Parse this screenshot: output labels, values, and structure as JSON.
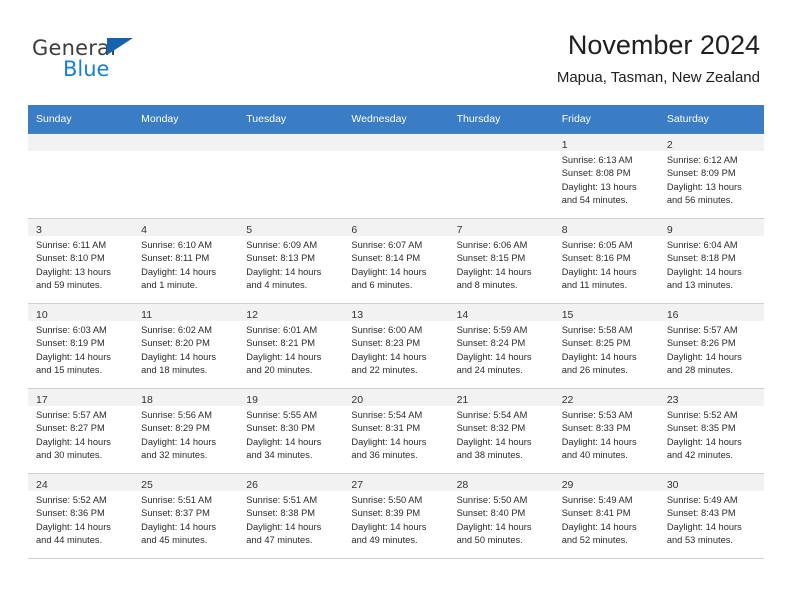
{
  "brand": {
    "name_top": "General",
    "name_bottom": "Blue",
    "triangle_color": "#1464ad",
    "blue_color": "#1a7fd4"
  },
  "header": {
    "title": "November 2024",
    "subtitle": "Mapua, Tasman, New Zealand"
  },
  "theme": {
    "header_row_bg": "#3b7dc4",
    "day_band_bg": "#f2f2f2",
    "cell_border": "#4c84c0"
  },
  "weekdays": [
    "Sunday",
    "Monday",
    "Tuesday",
    "Wednesday",
    "Thursday",
    "Friday",
    "Saturday"
  ],
  "weeks": [
    [
      {
        "day": "",
        "sunrise": "",
        "sunset": "",
        "daylight1": "",
        "daylight2": ""
      },
      {
        "day": "",
        "sunrise": "",
        "sunset": "",
        "daylight1": "",
        "daylight2": ""
      },
      {
        "day": "",
        "sunrise": "",
        "sunset": "",
        "daylight1": "",
        "daylight2": ""
      },
      {
        "day": "",
        "sunrise": "",
        "sunset": "",
        "daylight1": "",
        "daylight2": ""
      },
      {
        "day": "",
        "sunrise": "",
        "sunset": "",
        "daylight1": "",
        "daylight2": ""
      },
      {
        "day": "1",
        "sunrise": "Sunrise: 6:13 AM",
        "sunset": "Sunset: 8:08 PM",
        "daylight1": "Daylight: 13 hours",
        "daylight2": "and 54 minutes."
      },
      {
        "day": "2",
        "sunrise": "Sunrise: 6:12 AM",
        "sunset": "Sunset: 8:09 PM",
        "daylight1": "Daylight: 13 hours",
        "daylight2": "and 56 minutes."
      }
    ],
    [
      {
        "day": "3",
        "sunrise": "Sunrise: 6:11 AM",
        "sunset": "Sunset: 8:10 PM",
        "daylight1": "Daylight: 13 hours",
        "daylight2": "and 59 minutes."
      },
      {
        "day": "4",
        "sunrise": "Sunrise: 6:10 AM",
        "sunset": "Sunset: 8:11 PM",
        "daylight1": "Daylight: 14 hours",
        "daylight2": "and 1 minute."
      },
      {
        "day": "5",
        "sunrise": "Sunrise: 6:09 AM",
        "sunset": "Sunset: 8:13 PM",
        "daylight1": "Daylight: 14 hours",
        "daylight2": "and 4 minutes."
      },
      {
        "day": "6",
        "sunrise": "Sunrise: 6:07 AM",
        "sunset": "Sunset: 8:14 PM",
        "daylight1": "Daylight: 14 hours",
        "daylight2": "and 6 minutes."
      },
      {
        "day": "7",
        "sunrise": "Sunrise: 6:06 AM",
        "sunset": "Sunset: 8:15 PM",
        "daylight1": "Daylight: 14 hours",
        "daylight2": "and 8 minutes."
      },
      {
        "day": "8",
        "sunrise": "Sunrise: 6:05 AM",
        "sunset": "Sunset: 8:16 PM",
        "daylight1": "Daylight: 14 hours",
        "daylight2": "and 11 minutes."
      },
      {
        "day": "9",
        "sunrise": "Sunrise: 6:04 AM",
        "sunset": "Sunset: 8:18 PM",
        "daylight1": "Daylight: 14 hours",
        "daylight2": "and 13 minutes."
      }
    ],
    [
      {
        "day": "10",
        "sunrise": "Sunrise: 6:03 AM",
        "sunset": "Sunset: 8:19 PM",
        "daylight1": "Daylight: 14 hours",
        "daylight2": "and 15 minutes."
      },
      {
        "day": "11",
        "sunrise": "Sunrise: 6:02 AM",
        "sunset": "Sunset: 8:20 PM",
        "daylight1": "Daylight: 14 hours",
        "daylight2": "and 18 minutes."
      },
      {
        "day": "12",
        "sunrise": "Sunrise: 6:01 AM",
        "sunset": "Sunset: 8:21 PM",
        "daylight1": "Daylight: 14 hours",
        "daylight2": "and 20 minutes."
      },
      {
        "day": "13",
        "sunrise": "Sunrise: 6:00 AM",
        "sunset": "Sunset: 8:23 PM",
        "daylight1": "Daylight: 14 hours",
        "daylight2": "and 22 minutes."
      },
      {
        "day": "14",
        "sunrise": "Sunrise: 5:59 AM",
        "sunset": "Sunset: 8:24 PM",
        "daylight1": "Daylight: 14 hours",
        "daylight2": "and 24 minutes."
      },
      {
        "day": "15",
        "sunrise": "Sunrise: 5:58 AM",
        "sunset": "Sunset: 8:25 PM",
        "daylight1": "Daylight: 14 hours",
        "daylight2": "and 26 minutes."
      },
      {
        "day": "16",
        "sunrise": "Sunrise: 5:57 AM",
        "sunset": "Sunset: 8:26 PM",
        "daylight1": "Daylight: 14 hours",
        "daylight2": "and 28 minutes."
      }
    ],
    [
      {
        "day": "17",
        "sunrise": "Sunrise: 5:57 AM",
        "sunset": "Sunset: 8:27 PM",
        "daylight1": "Daylight: 14 hours",
        "daylight2": "and 30 minutes."
      },
      {
        "day": "18",
        "sunrise": "Sunrise: 5:56 AM",
        "sunset": "Sunset: 8:29 PM",
        "daylight1": "Daylight: 14 hours",
        "daylight2": "and 32 minutes."
      },
      {
        "day": "19",
        "sunrise": "Sunrise: 5:55 AM",
        "sunset": "Sunset: 8:30 PM",
        "daylight1": "Daylight: 14 hours",
        "daylight2": "and 34 minutes."
      },
      {
        "day": "20",
        "sunrise": "Sunrise: 5:54 AM",
        "sunset": "Sunset: 8:31 PM",
        "daylight1": "Daylight: 14 hours",
        "daylight2": "and 36 minutes."
      },
      {
        "day": "21",
        "sunrise": "Sunrise: 5:54 AM",
        "sunset": "Sunset: 8:32 PM",
        "daylight1": "Daylight: 14 hours",
        "daylight2": "and 38 minutes."
      },
      {
        "day": "22",
        "sunrise": "Sunrise: 5:53 AM",
        "sunset": "Sunset: 8:33 PM",
        "daylight1": "Daylight: 14 hours",
        "daylight2": "and 40 minutes."
      },
      {
        "day": "23",
        "sunrise": "Sunrise: 5:52 AM",
        "sunset": "Sunset: 8:35 PM",
        "daylight1": "Daylight: 14 hours",
        "daylight2": "and 42 minutes."
      }
    ],
    [
      {
        "day": "24",
        "sunrise": "Sunrise: 5:52 AM",
        "sunset": "Sunset: 8:36 PM",
        "daylight1": "Daylight: 14 hours",
        "daylight2": "and 44 minutes."
      },
      {
        "day": "25",
        "sunrise": "Sunrise: 5:51 AM",
        "sunset": "Sunset: 8:37 PM",
        "daylight1": "Daylight: 14 hours",
        "daylight2": "and 45 minutes."
      },
      {
        "day": "26",
        "sunrise": "Sunrise: 5:51 AM",
        "sunset": "Sunset: 8:38 PM",
        "daylight1": "Daylight: 14 hours",
        "daylight2": "and 47 minutes."
      },
      {
        "day": "27",
        "sunrise": "Sunrise: 5:50 AM",
        "sunset": "Sunset: 8:39 PM",
        "daylight1": "Daylight: 14 hours",
        "daylight2": "and 49 minutes."
      },
      {
        "day": "28",
        "sunrise": "Sunrise: 5:50 AM",
        "sunset": "Sunset: 8:40 PM",
        "daylight1": "Daylight: 14 hours",
        "daylight2": "and 50 minutes."
      },
      {
        "day": "29",
        "sunrise": "Sunrise: 5:49 AM",
        "sunset": "Sunset: 8:41 PM",
        "daylight1": "Daylight: 14 hours",
        "daylight2": "and 52 minutes."
      },
      {
        "day": "30",
        "sunrise": "Sunrise: 5:49 AM",
        "sunset": "Sunset: 8:43 PM",
        "daylight1": "Daylight: 14 hours",
        "daylight2": "and 53 minutes."
      }
    ]
  ]
}
